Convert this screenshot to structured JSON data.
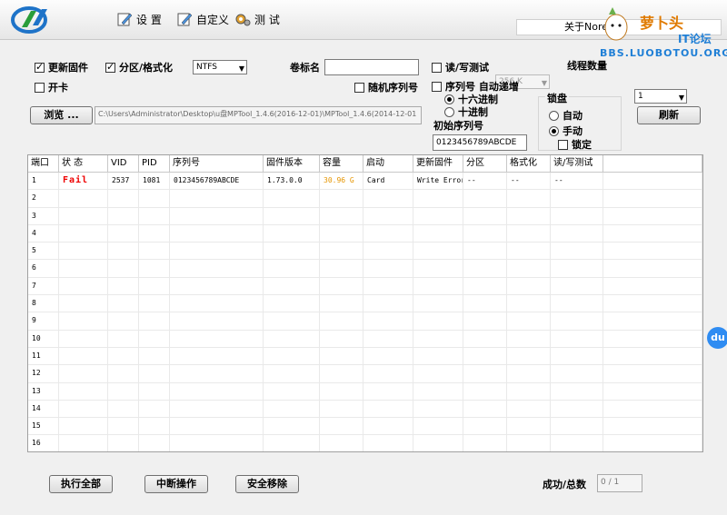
{
  "toolbar": {
    "settings_label": "设 置",
    "custom_label": "自定义",
    "test_label": "测 试",
    "about_text": "关于Nore"
  },
  "watermark": {
    "brand": "萝卜头",
    "forum": "IT论坛",
    "url": "BBS.LUOBOTOU.ORG"
  },
  "options": {
    "update_firmware_label": "更新固件",
    "update_firmware_checked": true,
    "partition_format_label": "分区/格式化",
    "partition_format_checked": true,
    "fs_select_value": "NTFS",
    "card_open_label": "开卡",
    "card_open_checked": false,
    "volume_label": "卷标名",
    "volume_value": "",
    "random_serial_label": "随机序列号",
    "random_serial_checked": false,
    "rw_test_label": "读/写测试",
    "rw_test_checked": false,
    "rw_size_value": "256 K",
    "thread_count_label": "线程数量",
    "thread_count_value": "1",
    "serial_auto_inc_label": "序列号 自动递增",
    "serial_auto_inc_checked": false,
    "hex_label": "十六进制",
    "hex_checked": true,
    "dec_label": "十进制",
    "dec_checked": false,
    "init_serial_label": "初始序列号",
    "init_serial_value": "0123456789ABCDE",
    "browse_label": "浏览 ...",
    "path_value": "C:\\Users\\Administrator\\Desktop\\u盘MPTool_1.4.6(2016-12-01)\\MPTool_1.4.6(2014-12-01"
  },
  "lock": {
    "title": "锁盘",
    "auto_label": "自动",
    "auto_checked": false,
    "manual_label": "手动",
    "manual_checked": true,
    "lock_label": "锁定",
    "lock_checked": false
  },
  "refresh_label": "刷新",
  "table": {
    "headers": [
      "端口",
      "状 态",
      "VID",
      "PID",
      "序列号",
      "固件版本",
      "容量",
      "启动",
      "更新固件",
      "分区",
      "格式化",
      "读/写测试",
      ""
    ],
    "rows": [
      {
        "port": "1",
        "status": "Fail",
        "vid": "2537",
        "pid": "1081",
        "serial": "0123456789ABCDE",
        "fw": "1.73.0.0",
        "cap": "30.96 G",
        "boot": "Card",
        "update": "Write Error",
        "part": "--",
        "fmt": "--",
        "rw": "--"
      },
      {
        "port": "2"
      },
      {
        "port": "3"
      },
      {
        "port": "4"
      },
      {
        "port": "5"
      },
      {
        "port": "6"
      },
      {
        "port": "7"
      },
      {
        "port": "8"
      },
      {
        "port": "9"
      },
      {
        "port": "10"
      },
      {
        "port": "11"
      },
      {
        "port": "12"
      },
      {
        "port": "13"
      },
      {
        "port": "14"
      },
      {
        "port": "15"
      },
      {
        "port": "16"
      }
    ]
  },
  "bottom": {
    "run_all_label": "执行全部",
    "abort_label": "中断操作",
    "safe_remove_label": "安全移除",
    "success_total_label": "成功/总数",
    "success_total_value": "0 / 1"
  },
  "colors": {
    "fail": "#e00000",
    "capacity": "#e69500",
    "accent": "#1f7fd6"
  }
}
